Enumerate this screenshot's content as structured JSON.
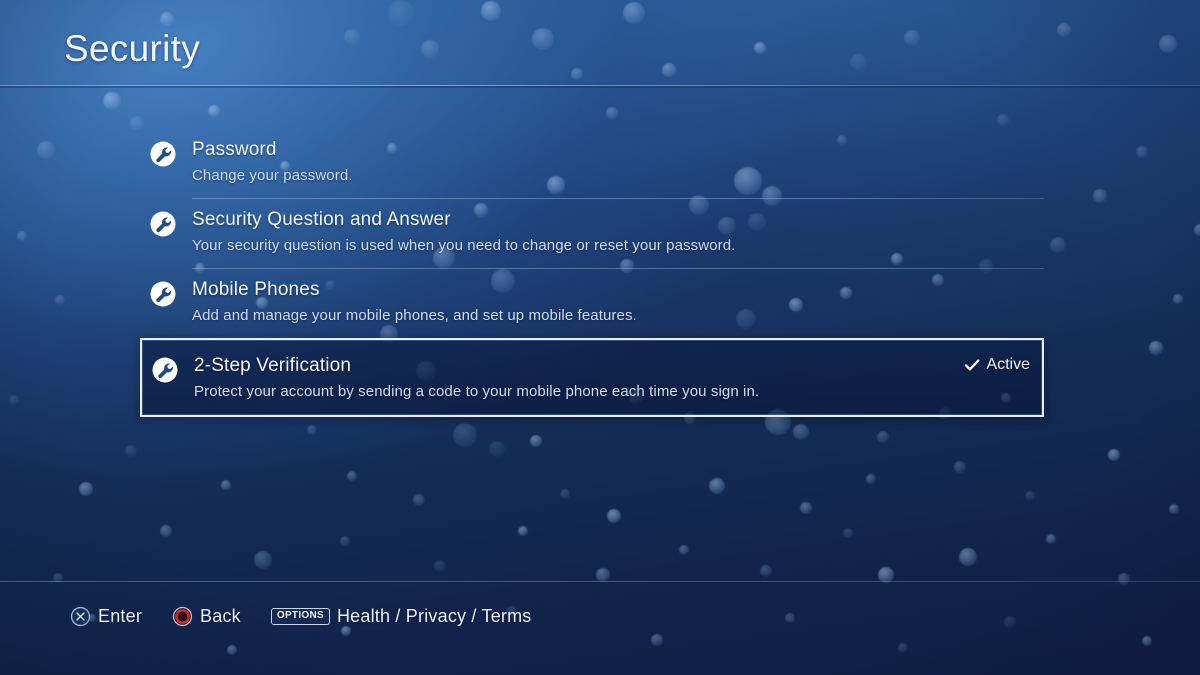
{
  "header": {
    "title": "Security"
  },
  "menu": {
    "items": [
      {
        "id": "password",
        "title": "Password",
        "description": "Change your password.",
        "icon": "wrench-icon",
        "status": "",
        "selected": false
      },
      {
        "id": "security-question-and-answer",
        "title": "Security Question and Answer",
        "description": "Your security question is used when you need to change or reset your password.",
        "icon": "wrench-icon",
        "status": "",
        "selected": false
      },
      {
        "id": "mobile-phones",
        "title": "Mobile Phones",
        "description": "Add and manage your mobile phones, and set up mobile features.",
        "icon": "wrench-icon",
        "status": "",
        "selected": false
      },
      {
        "id": "2-step-verification",
        "title": "2-Step Verification",
        "description": "Protect your account by sending a code to your mobile phone each time you sign in.",
        "icon": "wrench-icon",
        "status": "Active",
        "status_icon": "check-icon",
        "selected": true
      }
    ]
  },
  "footer": {
    "hints": [
      {
        "id": "enter",
        "icon": "cross-button-icon",
        "label": "Enter"
      },
      {
        "id": "back",
        "icon": "circle-button-icon",
        "label": "Back"
      },
      {
        "id": "options",
        "icon": "options-button-icon",
        "badge": "OPTIONS",
        "label": "Health / Privacy / Terms"
      }
    ]
  },
  "colors": {
    "background_top": "#2c5f9e",
    "background_bottom": "#0f1f44",
    "text_primary": "#f4f7fc",
    "text_secondary": "#cfdcef",
    "highlight_border": "#e8eefa",
    "circle_button_red": "#d02b2b",
    "icon_circle": "#ffffff",
    "icon_glyph": "#1f4a88"
  }
}
